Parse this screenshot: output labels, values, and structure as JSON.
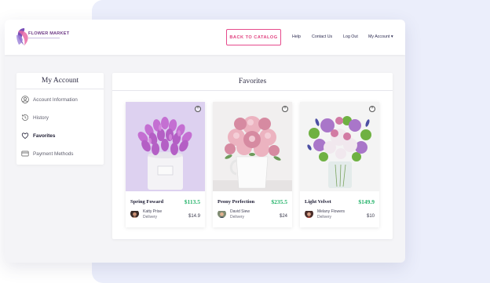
{
  "brand": {
    "name": "FLOWER MARKET"
  },
  "header": {
    "catalog_button": "BACK TO CATALOG",
    "nav": {
      "help": "Help",
      "contact": "Contact Us",
      "logout": "Log Out",
      "account": "My Account ▾"
    }
  },
  "sidebar": {
    "title": "My Account",
    "items": [
      {
        "label": "Account Information",
        "icon": "user-icon"
      },
      {
        "label": "History",
        "icon": "history-icon"
      },
      {
        "label": "Favorites",
        "icon": "heart-icon",
        "active": true
      },
      {
        "label": "Payment Methods",
        "icon": "credit-card-icon"
      }
    ]
  },
  "favorites": {
    "title": "Favorites",
    "items": [
      {
        "name": "Spring Foward",
        "price": "$113.5",
        "seller": "Katty Prise",
        "delivery_label": "Delivery",
        "delivery_price": "$14.9"
      },
      {
        "name": "Peony Perfection",
        "price": "$235.5",
        "seller": "David Siew",
        "delivery_label": "Delivery",
        "delivery_price": "$24"
      },
      {
        "name": "Light Velvet",
        "price": "$149.9",
        "seller": "Melany Flowers",
        "delivery_label": "Delivery",
        "delivery_price": "$10"
      }
    ]
  },
  "colors": {
    "accent_pink": "#e0417f",
    "price_green": "#28b46c",
    "brand_purple": "#6f3b87",
    "backdrop": "#ebeefb"
  }
}
